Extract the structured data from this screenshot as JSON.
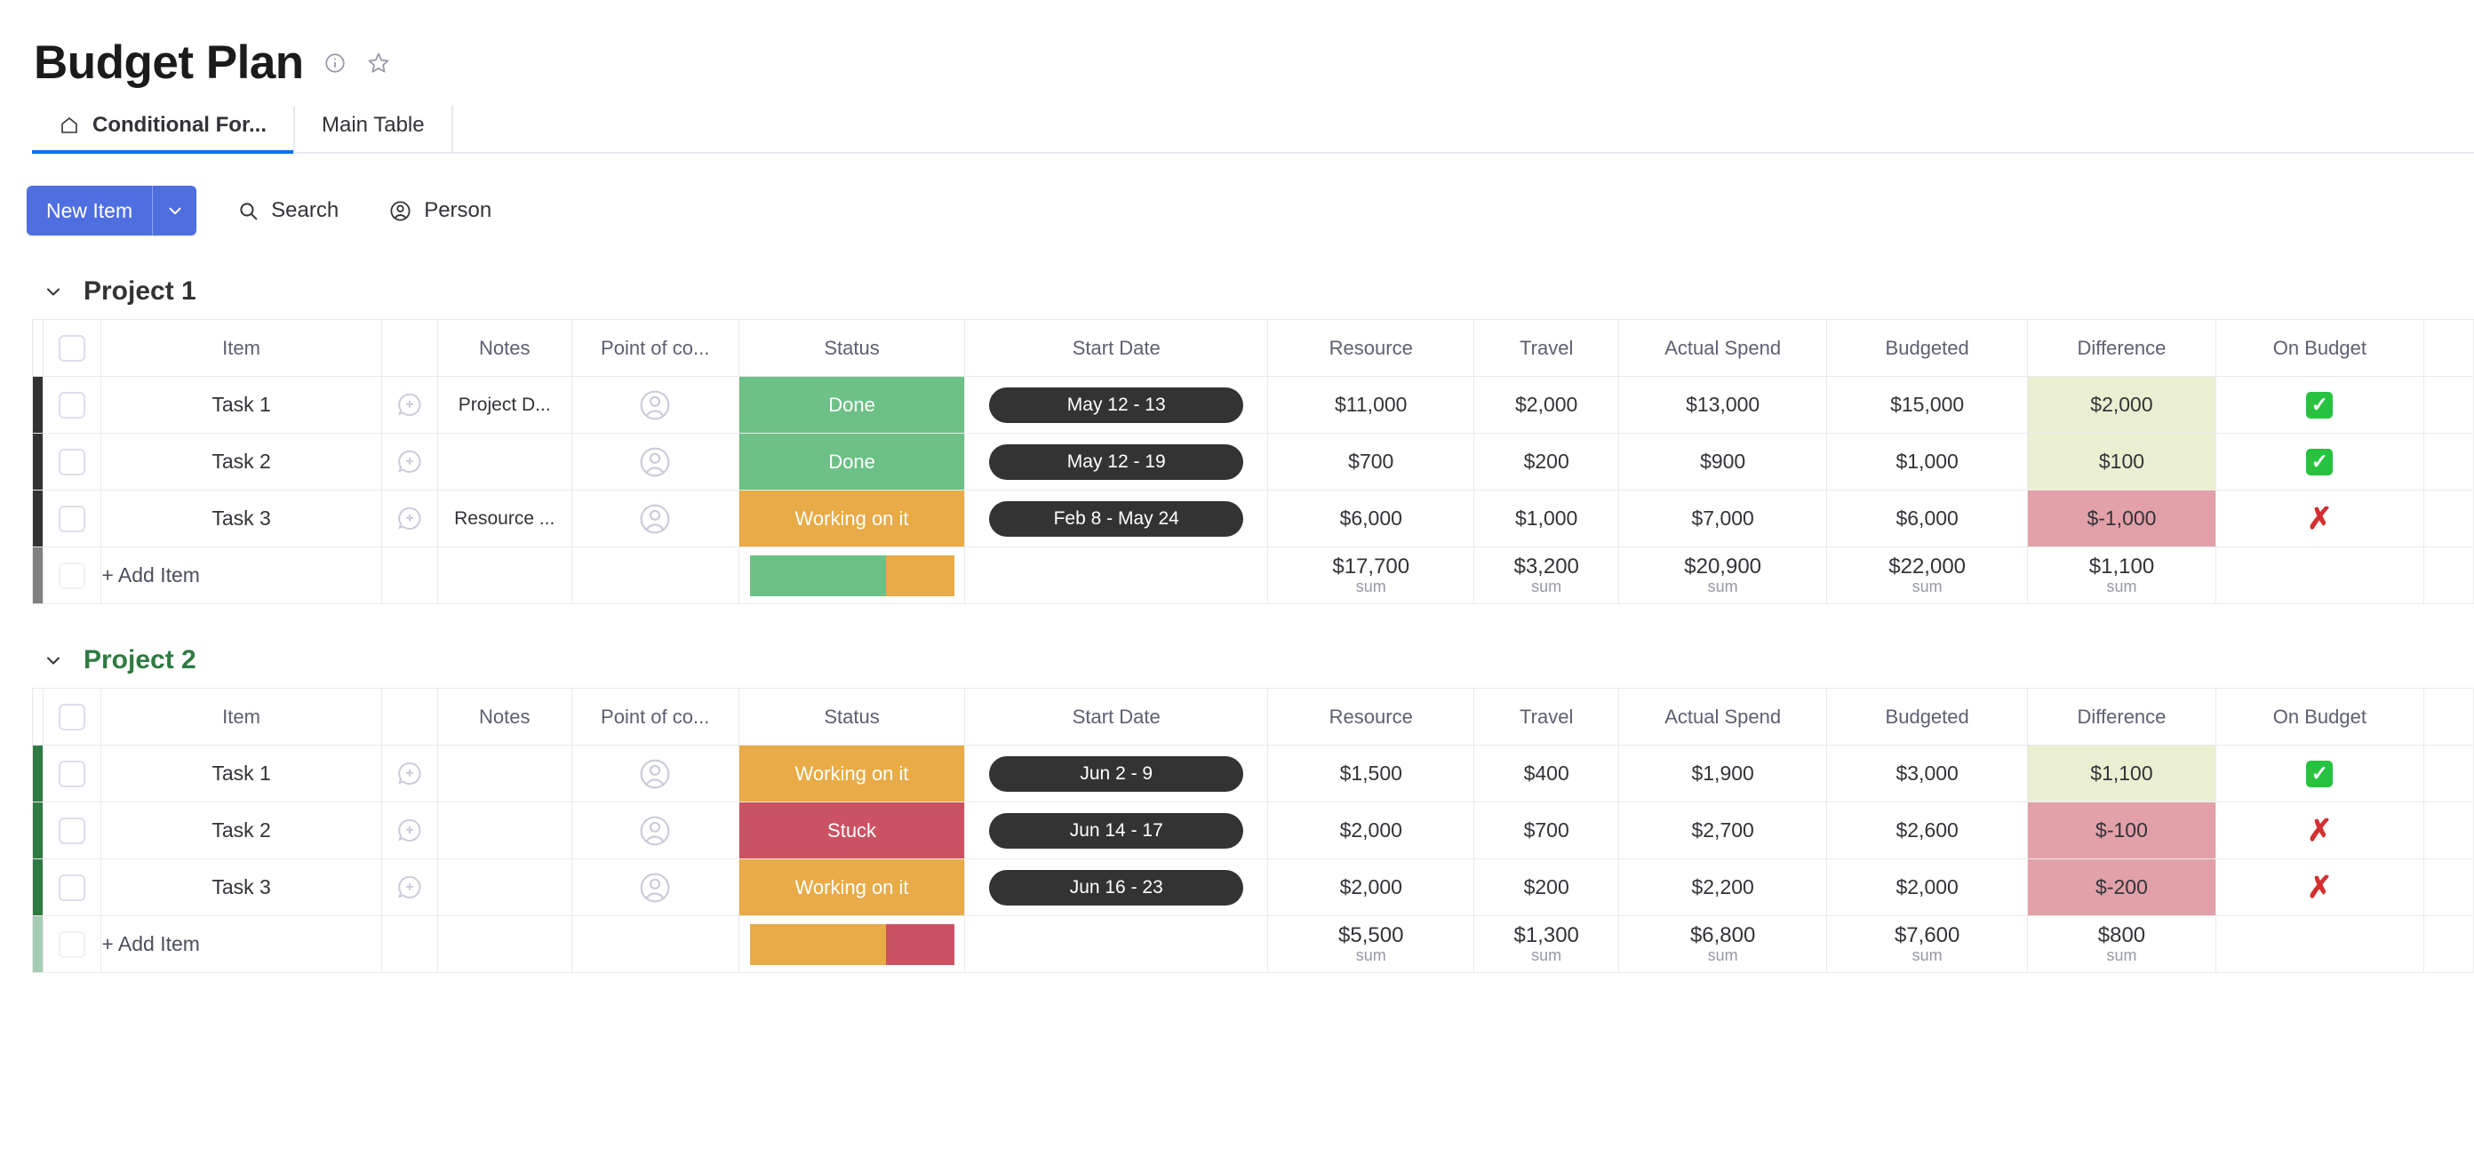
{
  "header": {
    "title": "Budget Plan",
    "info_icon": "info-circle-icon",
    "star_icon": "star-icon"
  },
  "tabs": [
    {
      "label": "Conditional For...",
      "icon": "home-icon",
      "active": true
    },
    {
      "label": "Main Table",
      "icon": "",
      "active": false
    }
  ],
  "toolbar": {
    "new_item_label": "New Item",
    "new_item_caret": "chevron-down-icon",
    "search_label": "Search",
    "person_label": "Person"
  },
  "columns": [
    "Item",
    "Notes",
    "Point of co...",
    "Status",
    "Start Date",
    "Resource",
    "Travel",
    "Actual Spend",
    "Budgeted",
    "Difference",
    "On Budget"
  ],
  "add_item_label": "+ Add Item",
  "sum_label": "sum",
  "colors": {
    "accent": "#4f6fe0",
    "tab_underline": "#0073ea",
    "done": "#6dc086",
    "working": "#e8ab47",
    "stuck": "#cb5262",
    "diff_positive_bg": "#ebefd2",
    "diff_negative_bg": "#e2a0a8",
    "group1_bar": "#333333",
    "group2_bar": "#2f7a43",
    "date_pill": "#333333"
  },
  "groups": [
    {
      "name": "Project 1",
      "color": "#333333",
      "caret": "chevron-down-icon",
      "rows": [
        {
          "item": "Task 1",
          "notes": "Project D...",
          "person": "",
          "status": "Done",
          "status_kind": "done",
          "date": "May 12 - 13",
          "resource": "$11,000",
          "travel": "$2,000",
          "actual": "$13,000",
          "budgeted": "$15,000",
          "difference": "$2,000",
          "difference_kind": "positive",
          "on_budget": "check",
          "on_budget_icon": "green-check-icon"
        },
        {
          "item": "Task 2",
          "notes": "",
          "person": "",
          "status": "Done",
          "status_kind": "done",
          "date": "May 12 - 19",
          "resource": "$700",
          "travel": "$200",
          "actual": "$900",
          "budgeted": "$1,000",
          "difference": "$100",
          "difference_kind": "positive",
          "on_budget": "check",
          "on_budget_icon": "green-check-icon"
        },
        {
          "item": "Task 3",
          "notes": "Resource ...",
          "person": "",
          "status": "Working on it",
          "status_kind": "working",
          "date": "Feb 8 - May 24",
          "resource": "$6,000",
          "travel": "$1,000",
          "actual": "$7,000",
          "budgeted": "$6,000",
          "difference": "$-1,000",
          "difference_kind": "negative",
          "on_budget": "cross",
          "on_budget_icon": "red-cross-icon"
        }
      ],
      "summary": {
        "status_bar": [
          {
            "kind": "done",
            "pct": 66.7
          },
          {
            "kind": "working",
            "pct": 33.3
          }
        ],
        "resource": "$17,700",
        "travel": "$3,200",
        "actual": "$20,900",
        "budgeted": "$22,000",
        "difference": "$1,100"
      }
    },
    {
      "name": "Project 2",
      "color": "#2f7a43",
      "caret": "chevron-down-icon",
      "rows": [
        {
          "item": "Task 1",
          "notes": "",
          "person": "",
          "status": "Working on it",
          "status_kind": "working",
          "date": "Jun 2 - 9",
          "resource": "$1,500",
          "travel": "$400",
          "actual": "$1,900",
          "budgeted": "$3,000",
          "difference": "$1,100",
          "difference_kind": "positive",
          "on_budget": "check",
          "on_budget_icon": "green-check-icon"
        },
        {
          "item": "Task 2",
          "notes": "",
          "person": "",
          "status": "Stuck",
          "status_kind": "stuck",
          "date": "Jun 14 - 17",
          "resource": "$2,000",
          "travel": "$700",
          "actual": "$2,700",
          "budgeted": "$2,600",
          "difference": "$-100",
          "difference_kind": "negative",
          "on_budget": "cross",
          "on_budget_icon": "red-cross-icon"
        },
        {
          "item": "Task 3",
          "notes": "",
          "person": "",
          "status": "Working on it",
          "status_kind": "working",
          "date": "Jun 16 - 23",
          "resource": "$2,000",
          "travel": "$200",
          "actual": "$2,200",
          "budgeted": "$2,000",
          "difference": "$-200",
          "difference_kind": "negative",
          "on_budget": "cross",
          "on_budget_icon": "red-cross-icon"
        }
      ],
      "summary": {
        "status_bar": [
          {
            "kind": "working",
            "pct": 66.7
          },
          {
            "kind": "stuck",
            "pct": 33.3
          }
        ],
        "resource": "$5,500",
        "travel": "$1,300",
        "actual": "$6,800",
        "budgeted": "$7,600",
        "difference": "$800"
      }
    }
  ]
}
